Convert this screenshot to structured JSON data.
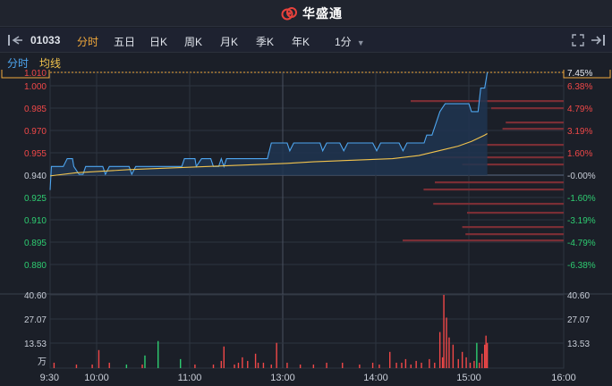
{
  "brand": {
    "name": "华盛通"
  },
  "toolbar": {
    "code": "01033",
    "tabs": [
      "分时",
      "五日",
      "日K",
      "周K",
      "月K",
      "季K",
      "年K",
      "1分"
    ],
    "active_tab": "分时"
  },
  "legend": {
    "line1": "分时",
    "line2": "均线"
  },
  "colors": {
    "background": "#1b1f28",
    "price_line": "#4ea6f0",
    "avg_line": "#f2c34d",
    "up": "#f04848",
    "down": "#2ecc71",
    "grid": "#2e3440"
  },
  "chart_data": {
    "type": "line",
    "prev_close": 0.94,
    "price_ticks_left": [
      "1.010",
      "1.000",
      "0.985",
      "0.970",
      "0.955",
      "0.940",
      "0.925",
      "0.910",
      "0.895",
      "0.880"
    ],
    "price_ticks_right": [
      "7.45%",
      "6.38%",
      "4.79%",
      "3.19%",
      "1.60%",
      "-0.00%",
      "-1.60%",
      "-3.19%",
      "-4.79%",
      "-6.38%"
    ],
    "ylim": [
      0.875,
      1.01
    ],
    "volume_ticks": [
      "40.60",
      "27.07",
      "13.53",
      "万"
    ],
    "volume_ylim": [
      0,
      40.6
    ],
    "x_ticks": [
      "9:30",
      "10:00",
      "11:00",
      "13:00",
      "14:00",
      "15:00",
      "16:00"
    ],
    "price_series": [
      [
        0,
        0.935
      ],
      [
        1,
        0.95
      ],
      [
        10,
        0.95
      ],
      [
        13,
        0.955
      ],
      [
        17,
        0.955
      ],
      [
        18,
        0.95
      ],
      [
        22,
        0.945
      ],
      [
        25,
        0.945
      ],
      [
        27,
        0.95
      ],
      [
        40,
        0.95
      ],
      [
        42,
        0.945
      ],
      [
        45,
        0.95
      ],
      [
        60,
        0.95
      ],
      [
        62,
        0.945
      ],
      [
        65,
        0.95
      ],
      [
        100,
        0.95
      ],
      [
        102,
        0.955
      ],
      [
        110,
        0.955
      ],
      [
        111,
        0.95
      ],
      [
        115,
        0.955
      ],
      [
        122,
        0.955
      ],
      [
        124,
        0.95
      ],
      [
        128,
        0.95
      ],
      [
        130,
        0.955
      ],
      [
        132,
        0.95
      ],
      [
        134,
        0.955
      ],
      [
        160,
        0.955
      ],
      [
        165,
        0.955
      ],
      [
        168,
        0.965
      ],
      [
        180,
        0.965
      ],
      [
        182,
        0.96
      ],
      [
        185,
        0.965
      ],
      [
        205,
        0.965
      ],
      [
        207,
        0.96
      ],
      [
        210,
        0.965
      ],
      [
        220,
        0.965
      ],
      [
        223,
        0.96
      ],
      [
        226,
        0.965
      ],
      [
        240,
        0.965
      ],
      [
        245,
        0.965
      ],
      [
        248,
        0.96
      ],
      [
        251,
        0.965
      ],
      [
        265,
        0.965
      ],
      [
        268,
        0.96
      ],
      [
        271,
        0.965
      ],
      [
        284,
        0.965
      ],
      [
        286,
        0.97
      ],
      [
        290,
        0.97
      ],
      [
        296,
        0.985
      ],
      [
        300,
        0.99
      ],
      [
        318,
        0.99
      ],
      [
        320,
        0.985
      ],
      [
        325,
        0.985
      ],
      [
        327,
        1.0
      ],
      [
        330,
        1.0
      ],
      [
        332,
        1.01
      ]
    ],
    "avg_series": [
      [
        0,
        0.944
      ],
      [
        20,
        0.946
      ],
      [
        40,
        0.947
      ],
      [
        60,
        0.948
      ],
      [
        90,
        0.949
      ],
      [
        120,
        0.95
      ],
      [
        150,
        0.951
      ],
      [
        180,
        0.952
      ],
      [
        200,
        0.953
      ],
      [
        230,
        0.954
      ],
      [
        260,
        0.955
      ],
      [
        280,
        0.957
      ],
      [
        295,
        0.96
      ],
      [
        310,
        0.963
      ],
      [
        320,
        0.966
      ],
      [
        330,
        0.97
      ],
      [
        332,
        0.971
      ]
    ],
    "volume_bars": [
      {
        "t": 3,
        "v": 3,
        "c": "up"
      },
      {
        "t": 20,
        "v": 2,
        "c": "up"
      },
      {
        "t": 32,
        "v": 2,
        "c": "up"
      },
      {
        "t": 37,
        "v": 10,
        "c": "up"
      },
      {
        "t": 45,
        "v": 3,
        "c": "up"
      },
      {
        "t": 58,
        "v": 2,
        "c": "down"
      },
      {
        "t": 70,
        "v": 2,
        "c": "up"
      },
      {
        "t": 72,
        "v": 7,
        "c": "down"
      },
      {
        "t": 82,
        "v": 15,
        "c": "down"
      },
      {
        "t": 99,
        "v": 5,
        "c": "down"
      },
      {
        "t": 110,
        "v": 2,
        "c": "up"
      },
      {
        "t": 124,
        "v": 2,
        "c": "up"
      },
      {
        "t": 130,
        "v": 4,
        "c": "up"
      },
      {
        "t": 132,
        "v": 12,
        "c": "up"
      },
      {
        "t": 140,
        "v": 2,
        "c": "up"
      },
      {
        "t": 143,
        "v": 3,
        "c": "up"
      },
      {
        "t": 146,
        "v": 6,
        "c": "up"
      },
      {
        "t": 150,
        "v": 4,
        "c": "up"
      },
      {
        "t": 156,
        "v": 8,
        "c": "up"
      },
      {
        "t": 158,
        "v": 3,
        "c": "up"
      },
      {
        "t": 162,
        "v": 3,
        "c": "up"
      },
      {
        "t": 168,
        "v": 2,
        "c": "up"
      },
      {
        "t": 172,
        "v": 14,
        "c": "up"
      },
      {
        "t": 180,
        "v": 3,
        "c": "up"
      },
      {
        "t": 190,
        "v": 2,
        "c": "up"
      },
      {
        "t": 200,
        "v": 2,
        "c": "up"
      },
      {
        "t": 210,
        "v": 3,
        "c": "up"
      },
      {
        "t": 222,
        "v": 3,
        "c": "up"
      },
      {
        "t": 235,
        "v": 2,
        "c": "up"
      },
      {
        "t": 245,
        "v": 3,
        "c": "up"
      },
      {
        "t": 250,
        "v": 2,
        "c": "up"
      },
      {
        "t": 258,
        "v": 9,
        "c": "up"
      },
      {
        "t": 263,
        "v": 3,
        "c": "up"
      },
      {
        "t": 267,
        "v": 3,
        "c": "up"
      },
      {
        "t": 270,
        "v": 5,
        "c": "up"
      },
      {
        "t": 274,
        "v": 2,
        "c": "up"
      },
      {
        "t": 278,
        "v": 4,
        "c": "up"
      },
      {
        "t": 282,
        "v": 3,
        "c": "up"
      },
      {
        "t": 288,
        "v": 5,
        "c": "up"
      },
      {
        "t": 292,
        "v": 3,
        "c": "up"
      },
      {
        "t": 296,
        "v": 20,
        "c": "up"
      },
      {
        "t": 298,
        "v": 6,
        "c": "up"
      },
      {
        "t": 299,
        "v": 40.6,
        "c": "up"
      },
      {
        "t": 301,
        "v": 28,
        "c": "up"
      },
      {
        "t": 303,
        "v": 17,
        "c": "up"
      },
      {
        "t": 306,
        "v": 13,
        "c": "up"
      },
      {
        "t": 310,
        "v": 5,
        "c": "up"
      },
      {
        "t": 313,
        "v": 9,
        "c": "up"
      },
      {
        "t": 316,
        "v": 6,
        "c": "up"
      },
      {
        "t": 319,
        "v": 3,
        "c": "up"
      },
      {
        "t": 322,
        "v": 4,
        "c": "up"
      },
      {
        "t": 324,
        "v": 14,
        "c": "down"
      },
      {
        "t": 326,
        "v": 3,
        "c": "up"
      },
      {
        "t": 328,
        "v": 8,
        "c": "up"
      },
      {
        "t": 330,
        "v": 13,
        "c": "up"
      },
      {
        "t": 331,
        "v": 18,
        "c": "up"
      },
      {
        "t": 332,
        "v": 14,
        "c": "up"
      }
    ],
    "order_book_depth": [
      {
        "price": 0.99,
        "size": 0.95
      },
      {
        "price": 0.985,
        "size": 0.45
      },
      {
        "price": 0.98,
        "size": 0.36
      },
      {
        "price": 0.975,
        "size": 0.38
      },
      {
        "price": 0.965,
        "size": 0.58
      },
      {
        "price": 0.96,
        "size": 0.82
      },
      {
        "price": 0.955,
        "size": 0.63
      },
      {
        "price": 0.945,
        "size": 0.8
      },
      {
        "price": 0.94,
        "size": 0.87
      },
      {
        "price": 0.935,
        "size": 0.81
      },
      {
        "price": 0.93,
        "size": 0.6
      },
      {
        "price": 0.92,
        "size": 0.63
      },
      {
        "price": 0.91,
        "size": 0.61
      },
      {
        "price": 0.9,
        "size": 2.0
      }
    ]
  }
}
